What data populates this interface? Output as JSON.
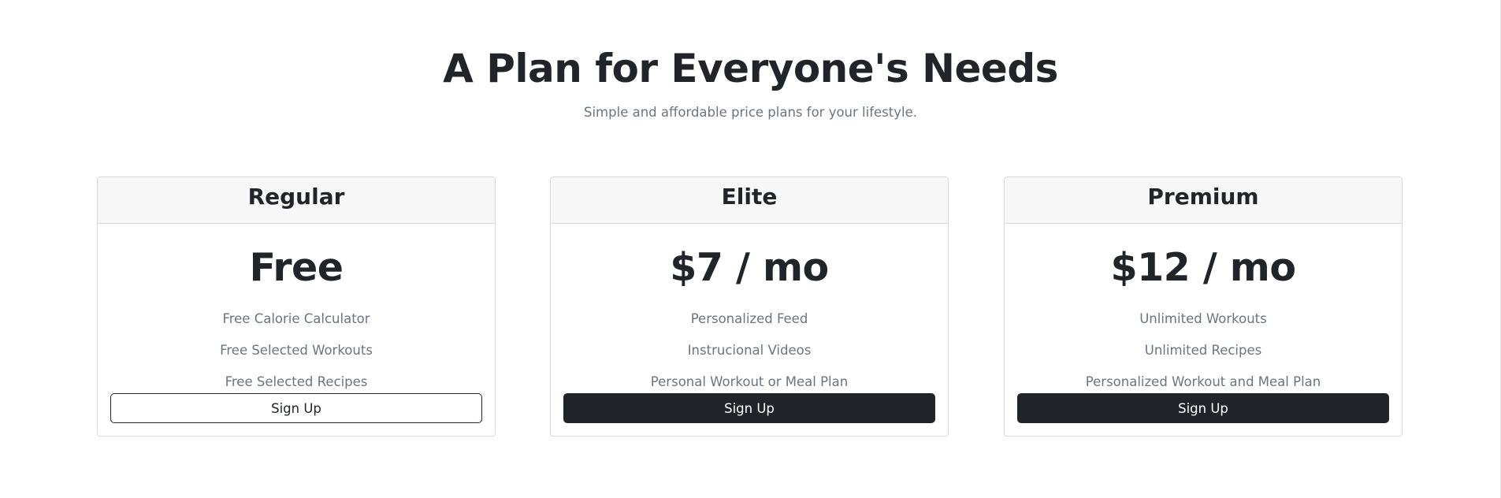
{
  "pricing": {
    "title": "A Plan for Everyone's Needs",
    "subtitle": "Simple and affordable price plans for your lifestyle.",
    "plans": [
      {
        "name": "Regular",
        "price": "Free",
        "features": [
          "Free Calorie Calculator",
          "Free Selected Workouts",
          "Free Selected Recipes"
        ],
        "button_label": "Sign Up",
        "button_style": "outline"
      },
      {
        "name": "Elite",
        "price": "$7 / mo",
        "features": [
          "Personalized Feed",
          "Instrucional Videos",
          "Personal Workout or Meal Plan"
        ],
        "button_label": "Sign Up",
        "button_style": "solid"
      },
      {
        "name": "Premium",
        "price": "$12 / mo",
        "features": [
          "Unlimited Workouts",
          "Unlimited Recipes",
          "Personalized Workout and Meal Plan"
        ],
        "button_label": "Sign Up",
        "button_style": "solid"
      }
    ]
  },
  "colors": {
    "text_dark": "#212529",
    "text_muted": "#6c757d",
    "card_header_bg": "#f7f7f7",
    "card_border": "#d9d9d9"
  }
}
